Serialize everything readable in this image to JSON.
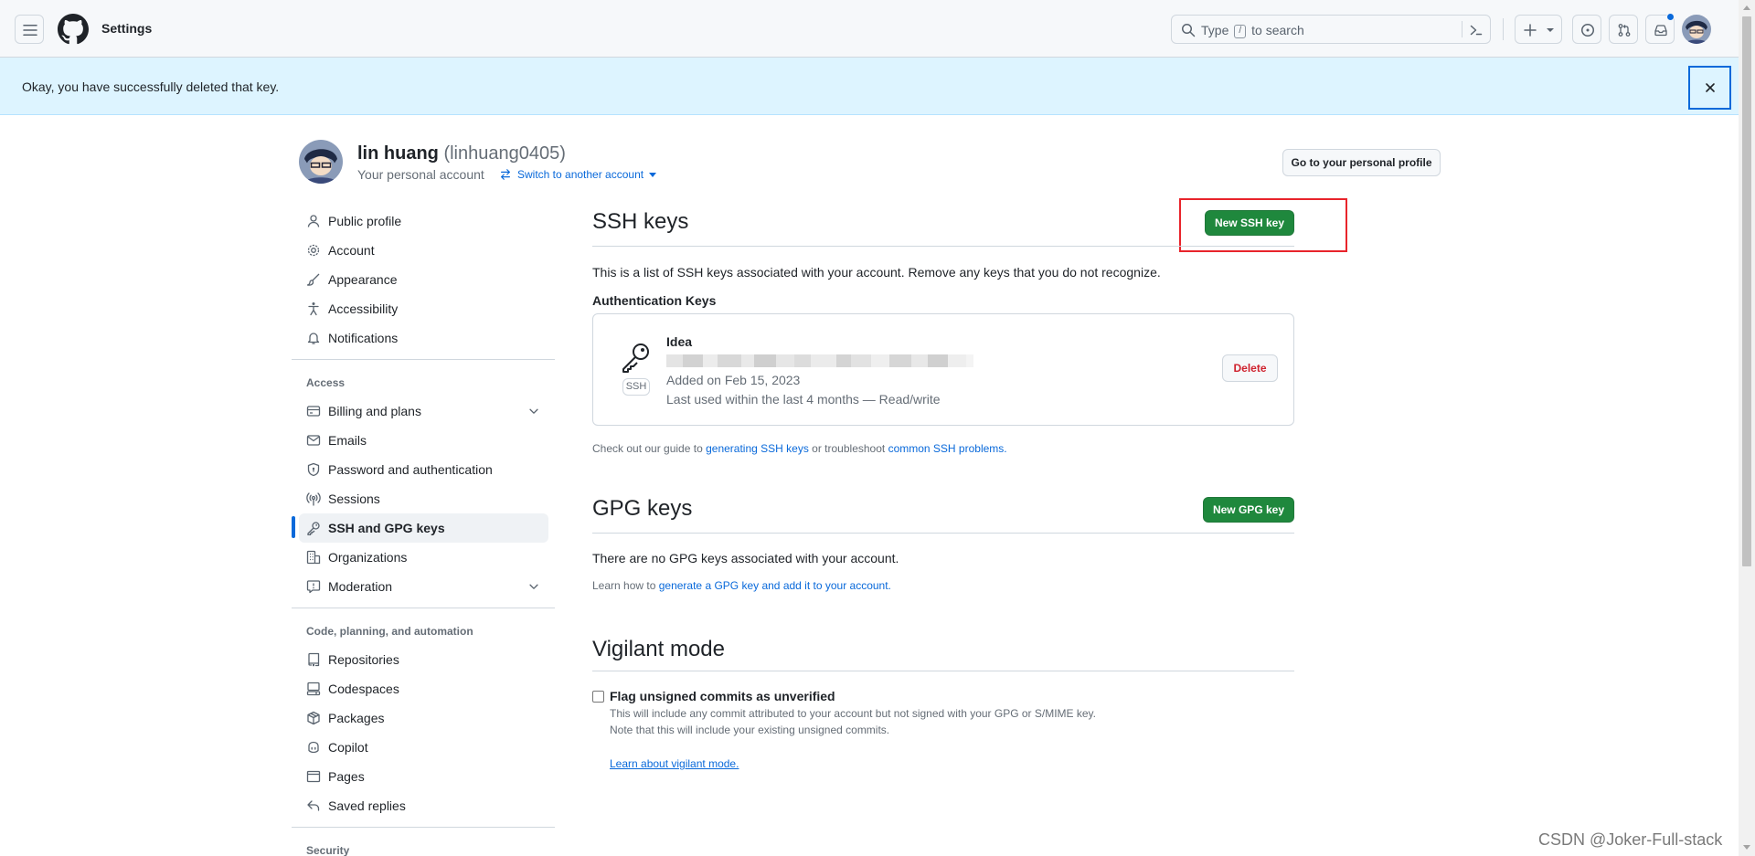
{
  "header": {
    "breadcrumb": "Settings",
    "search_prefix": "Type",
    "search_key": "/",
    "search_suffix": "to search"
  },
  "flash": {
    "message": "Okay, you have successfully deleted that key."
  },
  "profile": {
    "name": "lin huang",
    "login": "(linhuang0405)",
    "subtitle": "Your personal account",
    "switch_label": "Switch to another account",
    "go_to_profile": "Go to your personal profile"
  },
  "sidebar": {
    "items_top": [
      {
        "label": "Public profile",
        "icon": "person-icon"
      },
      {
        "label": "Account",
        "icon": "gear-icon"
      },
      {
        "label": "Appearance",
        "icon": "paintbrush-icon"
      },
      {
        "label": "Accessibility",
        "icon": "accessibility-icon"
      },
      {
        "label": "Notifications",
        "icon": "bell-icon"
      }
    ],
    "access_heading": "Access",
    "items_access": [
      {
        "label": "Billing and plans",
        "icon": "credit-card-icon"
      },
      {
        "label": "Emails",
        "icon": "mail-icon"
      },
      {
        "label": "Password and authentication",
        "icon": "shield-lock-icon"
      },
      {
        "label": "Sessions",
        "icon": "broadcast-icon"
      },
      {
        "label": "SSH and GPG keys",
        "icon": "key-icon"
      },
      {
        "label": "Organizations",
        "icon": "organization-icon"
      },
      {
        "label": "Moderation",
        "icon": "report-icon"
      }
    ],
    "code_heading": "Code, planning, and automation",
    "items_code": [
      {
        "label": "Repositories",
        "icon": "repo-icon"
      },
      {
        "label": "Codespaces",
        "icon": "codespaces-icon"
      },
      {
        "label": "Packages",
        "icon": "package-icon"
      },
      {
        "label": "Copilot",
        "icon": "copilot-icon"
      },
      {
        "label": "Pages",
        "icon": "browser-icon"
      },
      {
        "label": "Saved replies",
        "icon": "reply-icon"
      }
    ],
    "security_heading": "Security"
  },
  "ssh": {
    "title": "SSH keys",
    "new_button": "New SSH key",
    "description": "This is a list of SSH keys associated with your account. Remove any keys that you do not recognize.",
    "auth_heading": "Authentication Keys",
    "key": {
      "title": "Idea",
      "badge": "SSH",
      "added": "Added on Feb 15, 2023",
      "last_used": "Last used within the last 4 months — Read/write",
      "delete_label": "Delete"
    },
    "guide_prefix": "Check out our guide to",
    "guide_link1": "generating SSH keys",
    "guide_middle": "or troubleshoot",
    "guide_link2": "common SSH problems."
  },
  "gpg": {
    "title": "GPG keys",
    "new_button": "New GPG key",
    "empty": "There are no GPG keys associated with your account.",
    "learn_prefix": "Learn how to",
    "learn_link": "generate a GPG key and add it to your account."
  },
  "vigilant": {
    "title": "Vigilant mode",
    "checkbox_label": "Flag unsigned commits as unverified",
    "checked": false,
    "note1": "This will include any commit attributed to your account but not signed with your GPG or S/MIME key.",
    "note2": "Note that this will include your existing unsigned commits.",
    "learn_link": "Learn about vigilant mode."
  },
  "watermark": "CSDN @Joker-Full-stack",
  "colors": {
    "primary_green": "#1f883d",
    "link_blue": "#0969da",
    "danger_red": "#cf222e",
    "flash_bg": "#ddf4ff",
    "annotation_red": "#e8242b"
  }
}
